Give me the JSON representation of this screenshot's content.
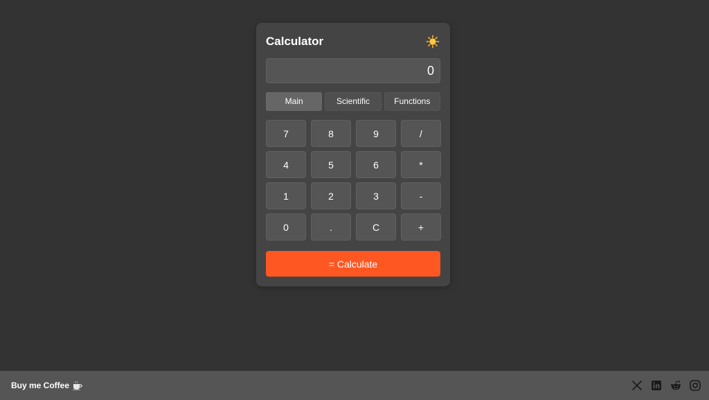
{
  "calculator": {
    "title": "Calculator",
    "theme_icon": "sun-icon",
    "display_value": "0",
    "tabs": [
      {
        "label": "Main",
        "active": true
      },
      {
        "label": "Scientific",
        "active": false
      },
      {
        "label": "Functions",
        "active": false
      }
    ],
    "keys": [
      "7",
      "8",
      "9",
      "/",
      "4",
      "5",
      "6",
      "*",
      "1",
      "2",
      "3",
      "-",
      "0",
      ".",
      "C",
      "+"
    ],
    "calculate_label": "= Calculate"
  },
  "footer": {
    "coffee_label": "Buy me Coffee",
    "coffee_icon": "coffee-cup-icon",
    "social_icons": [
      "x-icon",
      "linkedin-icon",
      "reddit-icon",
      "instagram-icon"
    ]
  },
  "colors": {
    "page_background": "#333333",
    "card_background": "#444444",
    "key_background": "#555555",
    "accent": "#ff5722",
    "footer_background": "#555555"
  }
}
